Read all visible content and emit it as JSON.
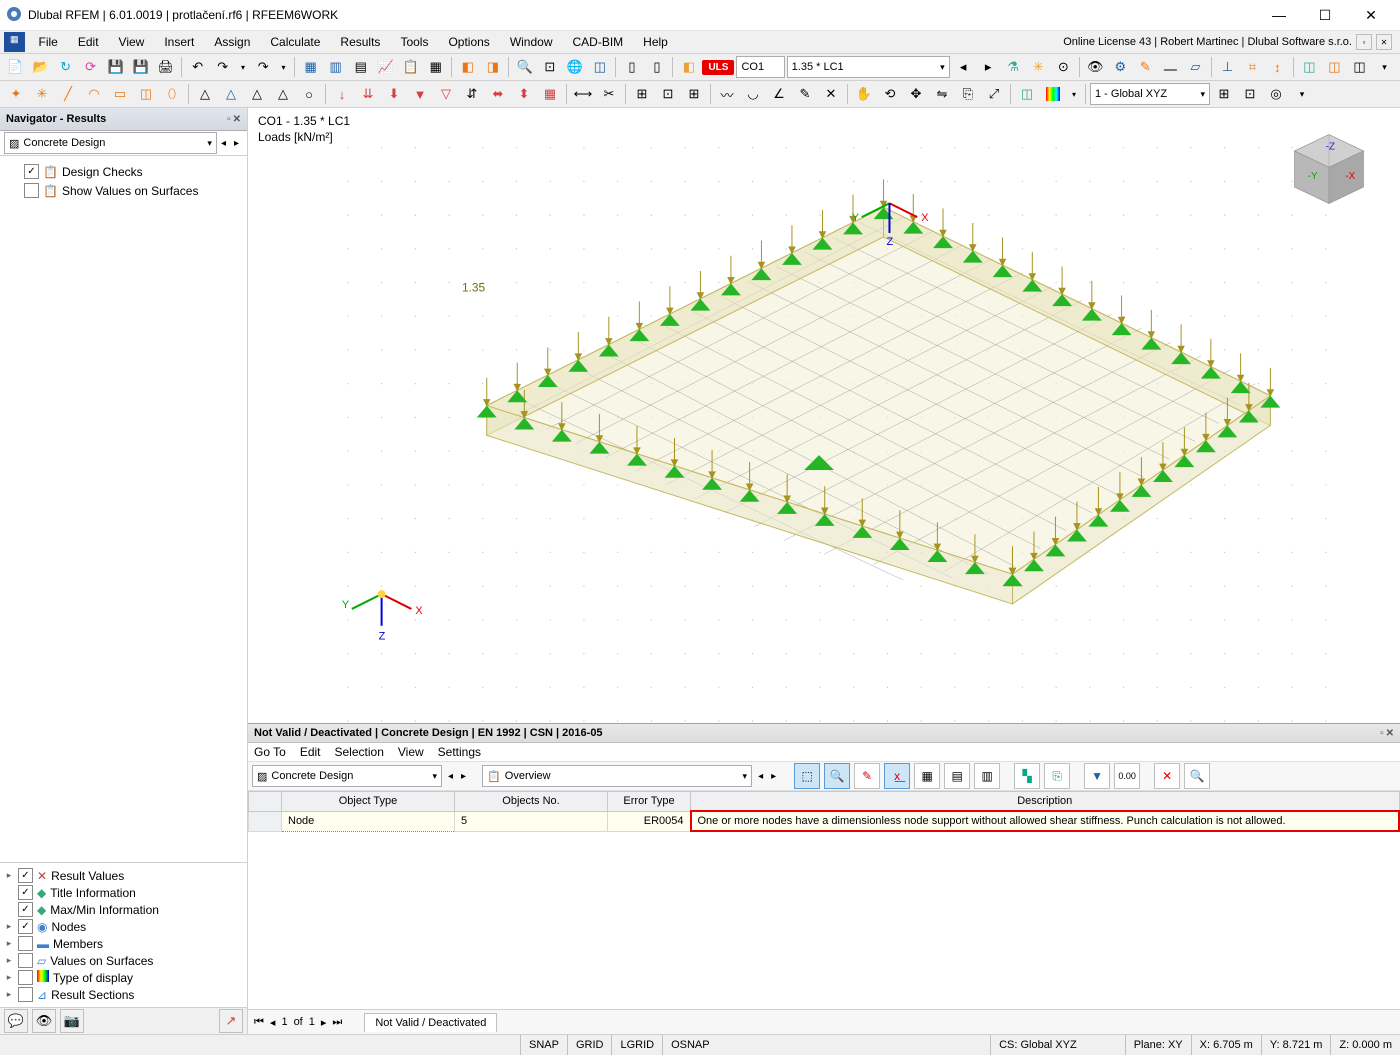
{
  "title": "Dlubal RFEM | 6.01.0019 | protlačení.rf6 | RFEEM6WORK",
  "menubar": [
    "File",
    "Edit",
    "View",
    "Insert",
    "Assign",
    "Calculate",
    "Results",
    "Tools",
    "Options",
    "Window",
    "CAD-BIM",
    "Help"
  ],
  "license": "Online License 43 | Robert Martinec | Dlubal Software s.r.o.",
  "toolbar1": {
    "uls": "ULS",
    "lc_id": "CO1",
    "lc_name": "1.35 * LC1",
    "coord_sys": "1 - Global XYZ"
  },
  "navigator": {
    "title": "Navigator - Results",
    "dropdown": "Concrete Design",
    "items": [
      {
        "label": "Design Checks",
        "checked": true
      },
      {
        "label": "Show Values on Surfaces",
        "checked": false
      }
    ]
  },
  "resulttree": [
    {
      "label": "Result Values",
      "checked": true
    },
    {
      "label": "Title Information",
      "checked": true
    },
    {
      "label": "Max/Min Information",
      "checked": true
    },
    {
      "label": "Nodes",
      "checked": true
    },
    {
      "label": "Members",
      "checked": false
    },
    {
      "label": "Values on Surfaces",
      "checked": false
    },
    {
      "label": "Type of display",
      "checked": false
    },
    {
      "label": "Result Sections",
      "checked": false
    }
  ],
  "viewport": {
    "lc": "CO1 - 1.35 * LC1",
    "loads": "Loads [kN/m²]",
    "load_value": "1.35"
  },
  "bottom": {
    "title": "Not Valid / Deactivated | Concrete Design | EN 1992 | CSN | 2016-05",
    "menu": [
      "Go To",
      "Edit",
      "Selection",
      "View",
      "Settings"
    ],
    "dropdown1": "Concrete Design",
    "dropdown2": "Overview",
    "headers": [
      "Object Type",
      "Objects No.",
      "Error Type",
      "Description"
    ],
    "row": {
      "object_type": "Node",
      "objects_no": "5",
      "error_type": "ER0054",
      "description": "One or more nodes have a dimensionless node support without allowed shear stiffness. Punch calculation is not allowed."
    },
    "pager": {
      "page": "1",
      "of": "of",
      "total": "1"
    },
    "tab": "Not Valid / Deactivated"
  },
  "statusbar": {
    "snap": "SNAP",
    "grid": "GRID",
    "lgrid": "LGRID",
    "osnap": "OSNAP",
    "cs": "CS: Global XYZ",
    "plane": "Plane: XY",
    "x": "X: 6.705 m",
    "y": "Y: 8.721 m",
    "z": "Z: 0.000 m"
  }
}
